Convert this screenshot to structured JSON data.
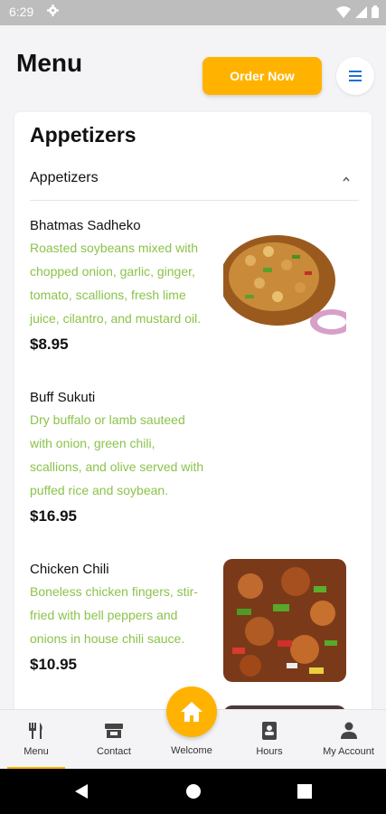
{
  "status": {
    "time": "6:29"
  },
  "header": {
    "title": "Menu",
    "order_label": "Order Now"
  },
  "section": {
    "title": "Appetizers",
    "accordion_label": "Appetizers",
    "items": [
      {
        "name": "Bhatmas Sadheko",
        "desc": "Roasted soybeans mixed with chopped onion, garlic, ginger, tomato, scallions, fresh lime juice, cilantro, and mustard oil.",
        "price": "$8.95"
      },
      {
        "name": "Buff Sukuti",
        "desc": "Dry buffalo or lamb sauteed with onion, green chili, scallions, and olive served with puffed rice and soybean.",
        "price": "$16.95"
      },
      {
        "name": "Chicken Chili",
        "desc": "Boneless chicken fingers, stir-fried with bell peppers and onions in house chili sauce.",
        "price": "$10.95"
      }
    ]
  },
  "nav": {
    "items": [
      {
        "label": "Menu",
        "icon": "fork-knife-icon"
      },
      {
        "label": "Contact",
        "icon": "store-icon"
      },
      {
        "label": "Welcome",
        "icon": "home-icon"
      },
      {
        "label": "Hours",
        "icon": "contact-book-icon"
      },
      {
        "label": "My Account",
        "icon": "person-icon"
      }
    ]
  },
  "colors": {
    "accent": "#ffb300",
    "description": "#8bc34a",
    "menu_icon": "#1e6fd9"
  }
}
